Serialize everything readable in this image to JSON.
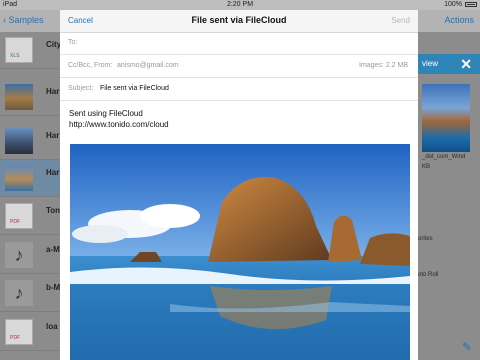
{
  "status": {
    "carrier": "iPad",
    "time": "2:20 PM",
    "battery": "100%"
  },
  "bg_app": {
    "back_label": "Samples",
    "actions_label": "Actions",
    "files": [
      {
        "label": "City",
        "icon": "xls-icon",
        "tag": "XLS"
      },
      {
        "label": "Har",
        "icon": "image-thumb"
      },
      {
        "label": "Har",
        "icon": "image-thumb"
      },
      {
        "label": "Har",
        "icon": "image-thumb"
      },
      {
        "label": "Ton",
        "icon": "pdf-icon",
        "tag": "PDF"
      },
      {
        "label": "a-M",
        "icon": "music-icon"
      },
      {
        "label": "b-M",
        "icon": "music-icon"
      },
      {
        "label": "loa",
        "icon": "pdf-icon",
        "tag": "PDF"
      }
    ],
    "preview_label": "view",
    "preview_caption1": "_dot_com_Wind",
    "preview_caption2": "KB",
    "preview_caption3": "orites",
    "preview_caption4": "oto Roll",
    "colors": {
      "accent": "#2f86b6",
      "link": "#2a6fb0"
    }
  },
  "compose": {
    "cancel_label": "Cancel",
    "title": "File sent via FileCloud",
    "send_label": "Send",
    "to_label": "To:",
    "ccbcc_label": "Cc/Bcc, From:",
    "from_value": "anismo@gmail.com",
    "images_label": "Images:",
    "images_size": "2.2 MB",
    "subject_label": "Subject:",
    "subject_value": "File sent via FileCloud",
    "body_line1": "Sent using FileCloud",
    "body_line2": "http://www.tonido.com/cloud"
  }
}
